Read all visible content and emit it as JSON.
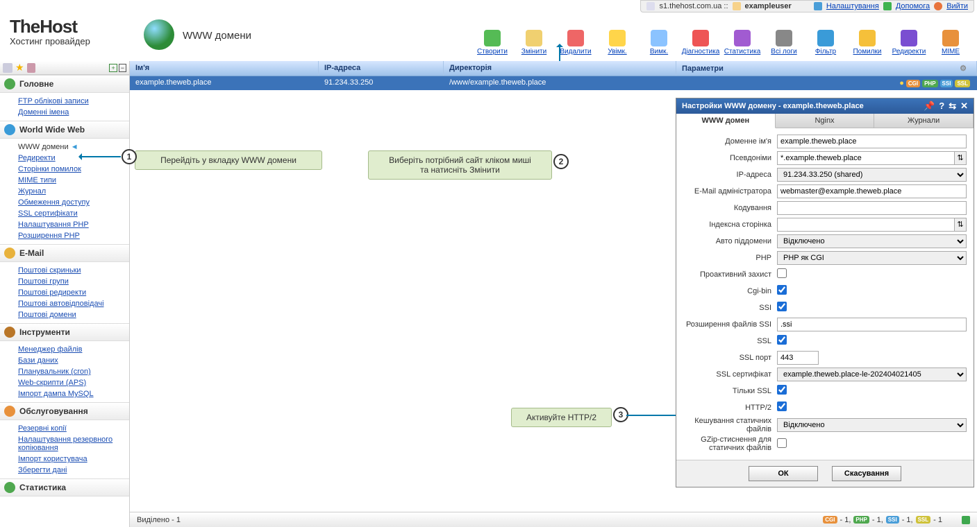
{
  "top": {
    "server": "s1.thehost.com.ua ::",
    "user": "exampleuser",
    "settings": "Налаштування",
    "help": "Допомога",
    "exit": "Вийти"
  },
  "brand": {
    "name": "TheHost",
    "sub": "Хостинг провайдер"
  },
  "page_title": "WWW домени",
  "toolbar": [
    {
      "k": "create",
      "l": "Створити",
      "c": "#5b5"
    },
    {
      "k": "edit",
      "l": "Змінити",
      "c": "#f0d070"
    },
    {
      "k": "delete",
      "l": "Видалити",
      "c": "#e66"
    },
    {
      "k": "enable",
      "l": "Увімк.",
      "c": "#ffd54a"
    },
    {
      "k": "disable",
      "l": "Вимк.",
      "c": "#8bc3ff"
    },
    {
      "k": "diag",
      "l": "Діагностика",
      "c": "#e55"
    },
    {
      "k": "stats",
      "l": "Статистика",
      "c": "#a15bd1"
    },
    {
      "k": "logs",
      "l": "Всі логи",
      "c": "#888"
    },
    {
      "k": "filter",
      "l": "Фільтр",
      "c": "#3a9bd8"
    },
    {
      "k": "errors",
      "l": "Помилки",
      "c": "#f5c03a"
    },
    {
      "k": "redir",
      "l": "Редиректи",
      "c": "#7a4ed1"
    },
    {
      "k": "mime",
      "l": "MIME",
      "c": "#e8913c"
    }
  ],
  "sidebar": {
    "sections": [
      {
        "title": "Головне",
        "icon": "#4fa84f",
        "items": [
          {
            "l": "FTP облікові записи"
          },
          {
            "l": "Доменні імена"
          }
        ]
      },
      {
        "title": "World Wide Web",
        "icon": "#3a9bd8",
        "items": [
          {
            "l": "WWW домени",
            "sel": true
          },
          {
            "l": "Редиректи"
          },
          {
            "l": "Сторінки помилок"
          },
          {
            "l": "MIME типи"
          },
          {
            "l": "Журнал"
          },
          {
            "l": "Обмеження доступу"
          },
          {
            "l": "SSL сертифікати"
          },
          {
            "l": "Налаштування PHP"
          },
          {
            "l": "Розширення PHP"
          }
        ]
      },
      {
        "title": "E-Mail",
        "icon": "#e8b23c",
        "items": [
          {
            "l": "Поштові скриньки"
          },
          {
            "l": "Поштові групи"
          },
          {
            "l": "Поштові редиректи"
          },
          {
            "l": "Поштові автовідповідачі"
          },
          {
            "l": "Поштові домени"
          }
        ]
      },
      {
        "title": "Інструменти",
        "icon": "#b97628",
        "items": [
          {
            "l": "Менеджер файлів"
          },
          {
            "l": "Бази даних"
          },
          {
            "l": "Планувальник (cron)"
          },
          {
            "l": "Web-скрипти (APS)"
          },
          {
            "l": "Імпорт дампа MySQL"
          }
        ]
      },
      {
        "title": "Обслуговування",
        "icon": "#e8913c",
        "items": [
          {
            "l": "Резервні копії"
          },
          {
            "l": "Налаштування резервного копіювання"
          },
          {
            "l": "Імпорт користувача"
          },
          {
            "l": "Зберегти дані"
          }
        ]
      },
      {
        "title": "Статистика",
        "icon": "#4fa84f",
        "items": []
      }
    ]
  },
  "table": {
    "head": {
      "name": "Ім'я",
      "ip": "IP-адреса",
      "dir": "Директорія",
      "par": "Параметри"
    },
    "row": {
      "name": "example.theweb.place",
      "ip": "91.234.33.250",
      "dir": "/www/example.theweb.place"
    }
  },
  "hints": {
    "h1": "Перейдіть у вкладку WWW домени",
    "h2": "Виберіть потрібний сайт кліком миші\nта натисніть Змінити",
    "h3": "Активуйте HTTP/2"
  },
  "panel": {
    "title": "Настройки WWW домену - example.theweb.place",
    "tabs": [
      "WWW домен",
      "Nginx",
      "Журнали"
    ],
    "ok": "ОК",
    "cancel": "Скасування",
    "fields": {
      "domain": {
        "l": "Доменне ім'я",
        "v": "example.theweb.place"
      },
      "alias": {
        "l": "Псевдоніми",
        "v": "*.example.theweb.place"
      },
      "ip": {
        "l": "IP-адреса",
        "v": "91.234.33.250 (shared)"
      },
      "email": {
        "l": "E-Mail адміністратора",
        "v": "webmaster@example.theweb.place"
      },
      "enc": {
        "l": "Кодування",
        "v": ""
      },
      "index": {
        "l": "Індексна сторінка",
        "v": ""
      },
      "autosub": {
        "l": "Авто піддомени",
        "v": "Відключено"
      },
      "php": {
        "l": "PHP",
        "v": "PHP як CGI"
      },
      "proact": {
        "l": "Проактивний захист"
      },
      "cgi": {
        "l": "Cgi-bin"
      },
      "ssi": {
        "l": "SSI"
      },
      "ssiext": {
        "l": "Розширення файлів SSI",
        "v": ".ssi"
      },
      "ssl": {
        "l": "SSL"
      },
      "sslport": {
        "l": "SSL порт",
        "v": "443"
      },
      "sslcert": {
        "l": "SSL сертифікат",
        "v": "example.theweb.place-le-202404021405"
      },
      "onlyssl": {
        "l": "Тільки SSL"
      },
      "http2": {
        "l": "HTTP/2"
      },
      "cache": {
        "l": "Кешування статичних файлів",
        "v": "Відключено"
      },
      "gzip": {
        "l": "GZip-стиснення для статичних файлів"
      }
    }
  },
  "status": {
    "sel": "Виділено - 1",
    "cgi": "- 1,",
    "php": "- 1,",
    "ssi": "- 1,",
    "ssl": "- 1"
  }
}
